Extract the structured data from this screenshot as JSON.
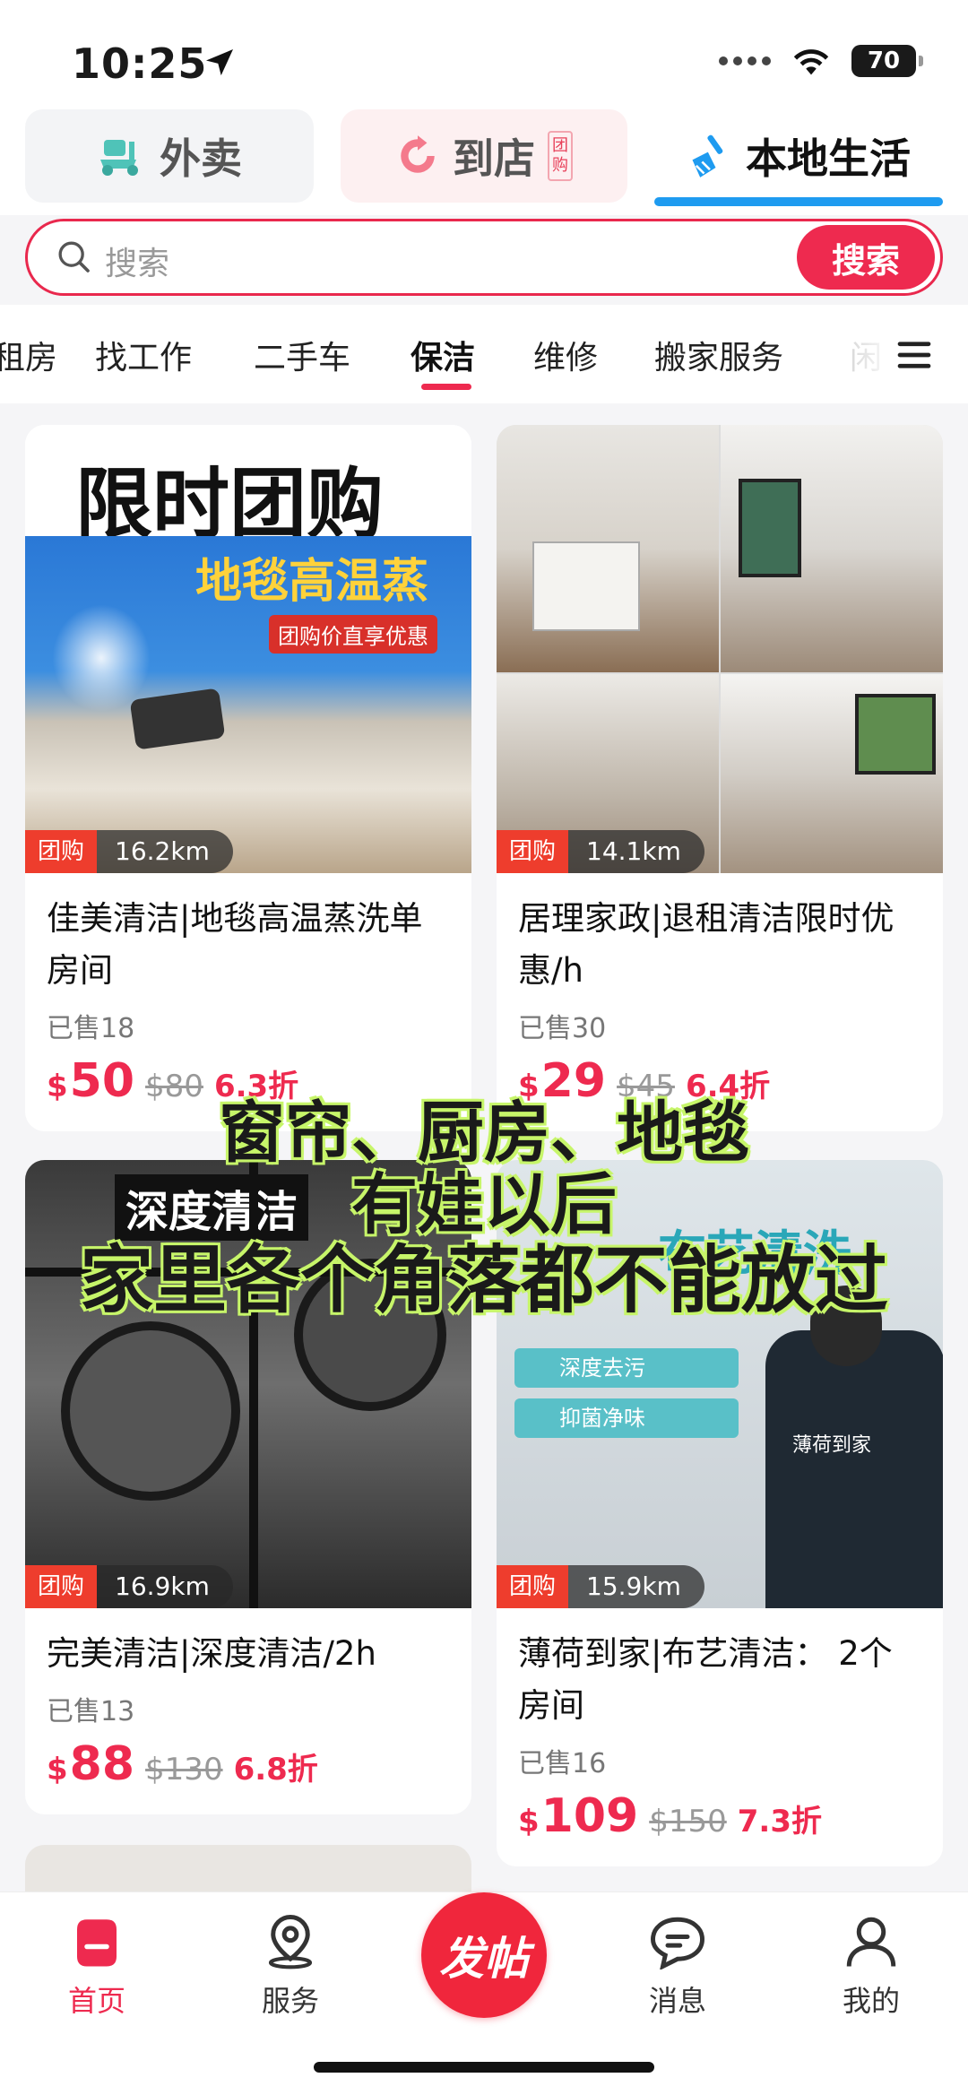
{
  "status": {
    "time": "10:25",
    "battery": "70"
  },
  "top_tabs": [
    {
      "label": "外卖"
    },
    {
      "label": "到店",
      "badge": "团购"
    },
    {
      "label": "本地生活"
    }
  ],
  "search": {
    "placeholder": "搜索",
    "button": "搜索"
  },
  "categories": [
    "租房",
    "找工作",
    "二手车",
    "保洁",
    "维修",
    "搬家服务",
    "闲"
  ],
  "active_category": "保洁",
  "cards": [
    {
      "img_headline": "限时团购",
      "img_banner": "地毯高温蒸",
      "img_tag": "团购价直享优惠",
      "badge": "团购",
      "distance": "16.2km",
      "title": "佳美清洁|地毯高温蒸洗单房间",
      "sold": "已售18",
      "currency": "$",
      "price": "50",
      "orig_price": "$80",
      "discount": "6.3折"
    },
    {
      "badge": "团购",
      "distance": "14.1km",
      "title": "居理家政|退租清洁限时优惠/h",
      "sold": "已售30",
      "currency": "$",
      "price": "29",
      "orig_price": "$45",
      "discount": "6.4折"
    },
    {
      "img_headline": "深度清洁",
      "badge": "团购",
      "distance": "16.9km",
      "title": "完美清洁|深度清洁/2h",
      "sold": "已售13",
      "currency": "$",
      "price": "88",
      "orig_price": "$130",
      "discount": "6.8折"
    },
    {
      "img_headline": "布艺清洗",
      "img_checks": [
        "深度去污",
        "抑菌净味"
      ],
      "img_logo": "薄荷到家",
      "badge": "团购",
      "distance": "15.9km",
      "title": "薄荷到家|布艺清洁： 2个房间",
      "sold": "已售16",
      "currency": "$",
      "price": "109",
      "orig_price": "$150",
      "discount": "7.3折"
    }
  ],
  "overlay_caption": [
    "窗帘、厨房、地毯",
    "有娃以后",
    "家里各个角落都不能放过"
  ],
  "bottom_nav": [
    {
      "label": "首页"
    },
    {
      "label": "服务"
    },
    {
      "label": "发帖"
    },
    {
      "label": "消息"
    },
    {
      "label": "我的"
    }
  ],
  "colors": {
    "accent": "#ee2a4f",
    "tab_underline": "#1e9bf0",
    "caption_outline": "#c7f56a"
  }
}
